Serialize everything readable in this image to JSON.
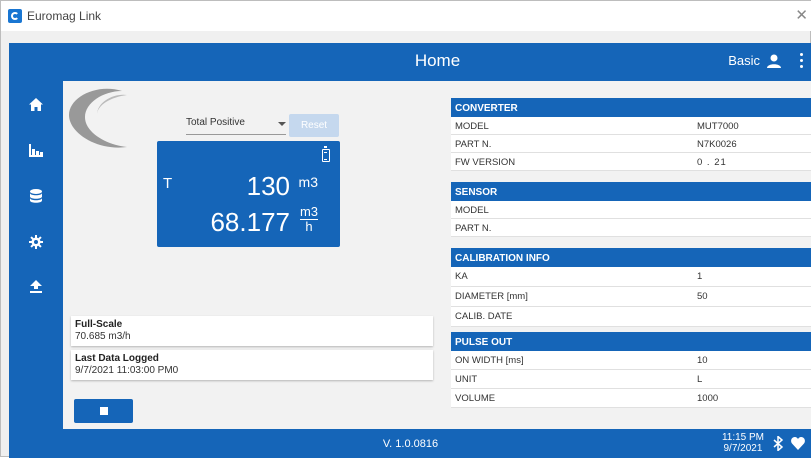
{
  "window": {
    "title": "Euromag Link"
  },
  "appbar": {
    "title": "Home",
    "user_level": "Basic"
  },
  "sidebar": {
    "items": [
      {
        "name": "home"
      },
      {
        "name": "chart"
      },
      {
        "name": "database"
      },
      {
        "name": "settings"
      },
      {
        "name": "upload"
      }
    ]
  },
  "totalizer": {
    "selected": "Total Positive",
    "reset_label": "Reset",
    "t_label": "T",
    "total_value": "130",
    "total_unit": "m3",
    "flow_value": "68.177",
    "flow_unit_num": "m3",
    "flow_unit_den": "h"
  },
  "full_scale": {
    "label": "Full-Scale",
    "value": "70.685 m3/h"
  },
  "last_logged": {
    "label": "Last Data Logged",
    "value": "9/7/2021 11:03:00 PM0"
  },
  "converter": {
    "title": "CONVERTER",
    "rows": [
      {
        "k": "MODEL",
        "v": "MUT7000"
      },
      {
        "k": "PART N.",
        "v": "N7K0026"
      },
      {
        "k": "FW VERSION",
        "v": "0 . 21"
      }
    ]
  },
  "sensor": {
    "title": "SENSOR",
    "rows": [
      {
        "k": "MODEL",
        "v": ""
      },
      {
        "k": "PART N.",
        "v": ""
      }
    ]
  },
  "calibration": {
    "title": "CALIBRATION INFO",
    "rows": [
      {
        "k": "KA",
        "v": "1"
      },
      {
        "k": "DIAMETER [mm]",
        "v": "50"
      },
      {
        "k": "CALIB. DATE",
        "v": ""
      }
    ]
  },
  "pulse_out": {
    "title": "PULSE OUT",
    "rows": [
      {
        "k": "ON WIDTH [ms]",
        "v": "10"
      },
      {
        "k": "UNIT",
        "v": "L"
      },
      {
        "k": "VOLUME",
        "v": "1000"
      }
    ]
  },
  "footer": {
    "version": "V. 1.0.0816",
    "time": "11:15 PM",
    "date": "9/7/2021"
  },
  "colors": {
    "primary": "#1565b8",
    "reset_disabled": "#c5d8ee"
  }
}
